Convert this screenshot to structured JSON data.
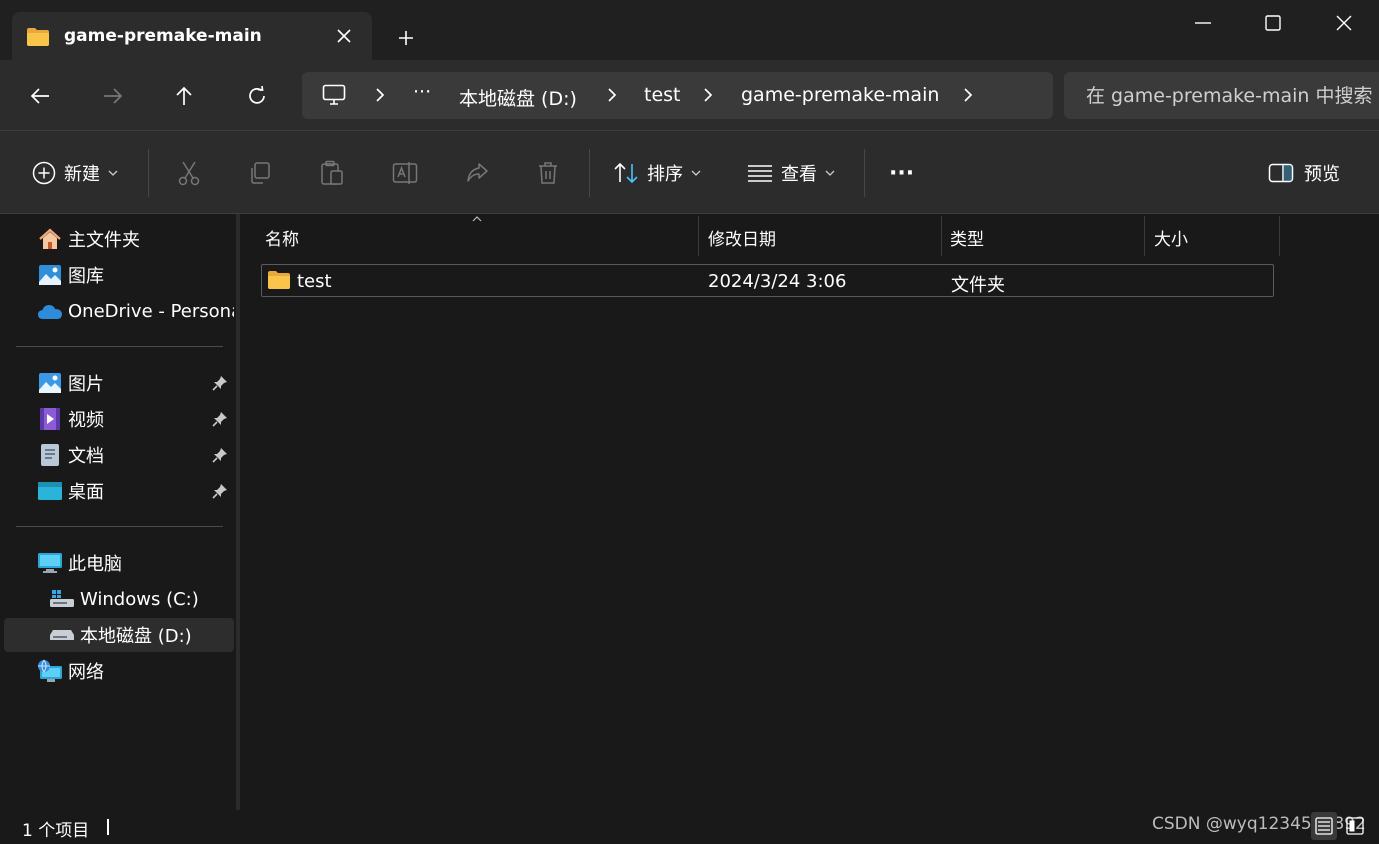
{
  "tab": {
    "title": "game-premake-main"
  },
  "nav": {
    "breadcrumb": [
      "本地磁盘 (D:)",
      "test",
      "game-premake-main"
    ],
    "overflow": "···",
    "search_placeholder": "在 game-premake-main 中搜索"
  },
  "toolbar": {
    "new_label": "新建",
    "sort_label": "排序",
    "view_label": "查看",
    "more_label": "···",
    "preview_label": "预览"
  },
  "sidebar": {
    "quick": [
      {
        "label": "主文件夹",
        "icon": "home-icon"
      },
      {
        "label": "图库",
        "icon": "gallery-icon"
      },
      {
        "label": "OneDrive - Persona",
        "icon": "onedrive-icon"
      }
    ],
    "pinned": [
      {
        "label": "图片",
        "icon": "pictures-icon"
      },
      {
        "label": "视频",
        "icon": "videos-icon"
      },
      {
        "label": "文档",
        "icon": "documents-icon"
      },
      {
        "label": "桌面",
        "icon": "desktop-icon"
      }
    ],
    "pc": {
      "label": "此电脑"
    },
    "drives": [
      {
        "label": "Windows (C:)",
        "icon": "windows-drive-icon"
      },
      {
        "label": "本地磁盘 (D:)",
        "icon": "drive-icon"
      }
    ],
    "network": {
      "label": "网络"
    }
  },
  "columns": {
    "name": "名称",
    "modified": "修改日期",
    "type": "类型",
    "size": "大小"
  },
  "files": [
    {
      "name": "test",
      "modified": "2024/3/24 3:06",
      "type": "文件夹",
      "size": ""
    }
  ],
  "status": {
    "count": "1 个项目"
  },
  "watermark": "CSDN @wyq1234567892",
  "colors": {
    "folder": "#f8c54a",
    "accent": "#4cc2ff"
  }
}
